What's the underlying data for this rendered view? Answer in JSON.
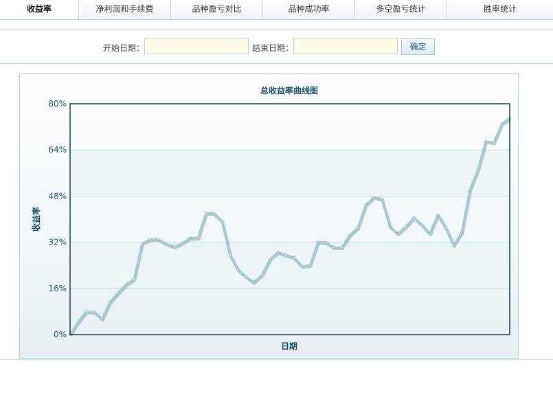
{
  "tabs": [
    {
      "label": "收益率",
      "active": true
    },
    {
      "label": "净利润和手续费",
      "active": false
    },
    {
      "label": "品种盈亏对比",
      "active": false
    },
    {
      "label": "品种成功率",
      "active": false
    },
    {
      "label": "多空盈亏统计",
      "active": false
    },
    {
      "label": "胜率统计",
      "active": false
    }
  ],
  "filter": {
    "start_label": "开始日期：",
    "end_label": "结束日期：",
    "start_value": "",
    "end_value": "",
    "confirm_label": "确定"
  },
  "colors": {
    "line": "#a9c9cf",
    "line_shadow": "#8aa1a6",
    "axis": "#1d3a45",
    "band": "#eef5f7",
    "grid": "#c7dee4"
  },
  "chart_data": {
    "type": "line",
    "title": "总收益率曲线图",
    "xlabel": "日期",
    "ylabel": "收益率",
    "ylim": [
      0,
      80
    ],
    "yticks": [
      "0%",
      "16%",
      "32%",
      "48%",
      "64%",
      "80%"
    ],
    "grid": true,
    "values": [
      0,
      4.3,
      7.9,
      7.9,
      5.5,
      11.3,
      14.4,
      17.3,
      19.2,
      31.5,
      33.0,
      33.1,
      31.5,
      30.4,
      31.6,
      33.5,
      33.5,
      42.0,
      42.0,
      39.3,
      27.7,
      22.5,
      20.0,
      18.2,
      20.6,
      26.1,
      28.5,
      27.6,
      26.7,
      23.7,
      24.0,
      32.0,
      32.0,
      30.2,
      30.2,
      34.5,
      37.0,
      45.0,
      47.5,
      47.0,
      37.5,
      35.0,
      37.4,
      40.5,
      38.0,
      35.0,
      41.5,
      37.0,
      31.0,
      35.5,
      50.0,
      57.0,
      67.0,
      66.5,
      73.0,
      75.0
    ]
  }
}
